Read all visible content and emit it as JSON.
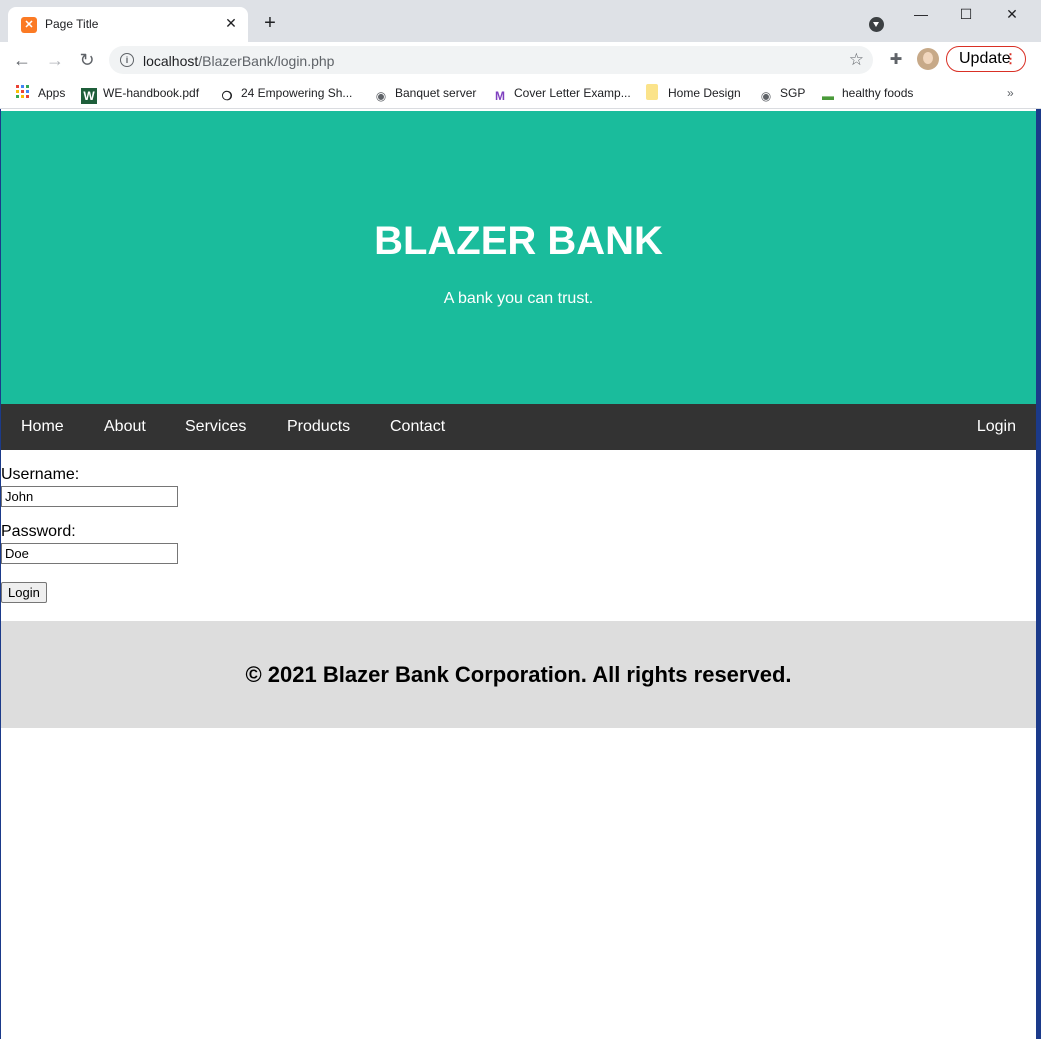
{
  "browser": {
    "tab_title": "Page Title",
    "tab_close": "✕",
    "new_tab": "+",
    "url_host": "localhost",
    "url_path": "/BlazerBank/login.php",
    "update_label": "Update",
    "window_controls": {
      "minimize": "—",
      "maximize": "☐",
      "close": "✕"
    },
    "bookmarks": [
      {
        "label": "Apps",
        "icon": "apps-grid-icon"
      },
      {
        "label": "WE-handbook.pdf",
        "icon": "w-logo-icon"
      },
      {
        "label": "24 Empowering Sh...",
        "icon": "speech-bubble-icon"
      },
      {
        "label": "Banquet server",
        "icon": "globe-icon"
      },
      {
        "label": "Cover Letter Examp...",
        "icon": "m-logo-icon"
      },
      {
        "label": "Home Design",
        "icon": "folder-icon"
      },
      {
        "label": "SGP",
        "icon": "globe-icon"
      },
      {
        "label": "healthy foods",
        "icon": "car-icon"
      }
    ],
    "bookmarks_overflow": "»"
  },
  "header": {
    "title": "BLAZER BANK",
    "subtitle": "A bank you can trust."
  },
  "nav": {
    "items": [
      "Home",
      "About",
      "Services",
      "Products",
      "Contact"
    ],
    "login": "Login"
  },
  "form": {
    "username_label": "Username:",
    "username_value": "John",
    "password_label": "Password:",
    "password_value": "Doe",
    "submit_label": "Login"
  },
  "footer": {
    "text": "© 2021 Blazer Bank Corporation. All rights reserved."
  },
  "colors": {
    "header_bg": "#1abc9c",
    "nav_bg": "#333333",
    "footer_bg": "#dddddd"
  }
}
